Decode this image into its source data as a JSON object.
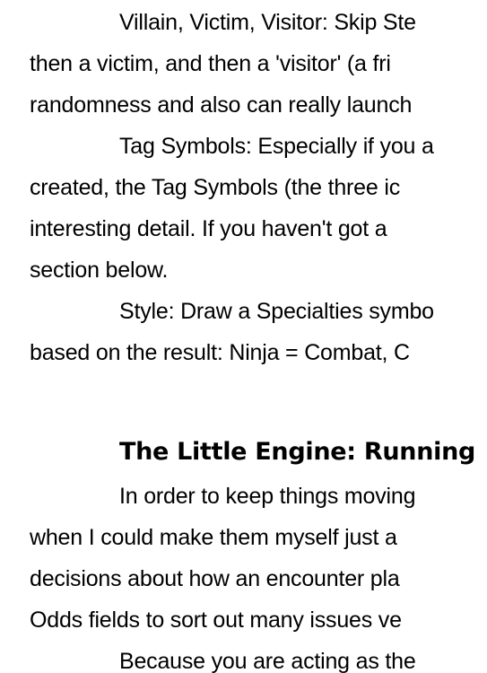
{
  "document": {
    "lines": [
      "Villain, Victim, Visitor: Skip Ste",
      "then a victim, and then a 'visitor' (a fri",
      "randomness and also can really launch",
      "Tag Symbols: Especially if you a",
      "created, the Tag Symbols (the three ic",
      "interesting detail. If you haven't got a",
      "section below.",
      "Style: Draw a Specialties symbo",
      "based on the result: Ninja = Combat, C"
    ],
    "heading": "The Little Engine: Running",
    "lines2": [
      "In order to keep things moving",
      "when I could make them myself just a",
      "decisions about how an encounter pla",
      "Odds fields to sort out many issues ve",
      "Because you are acting as the"
    ]
  }
}
